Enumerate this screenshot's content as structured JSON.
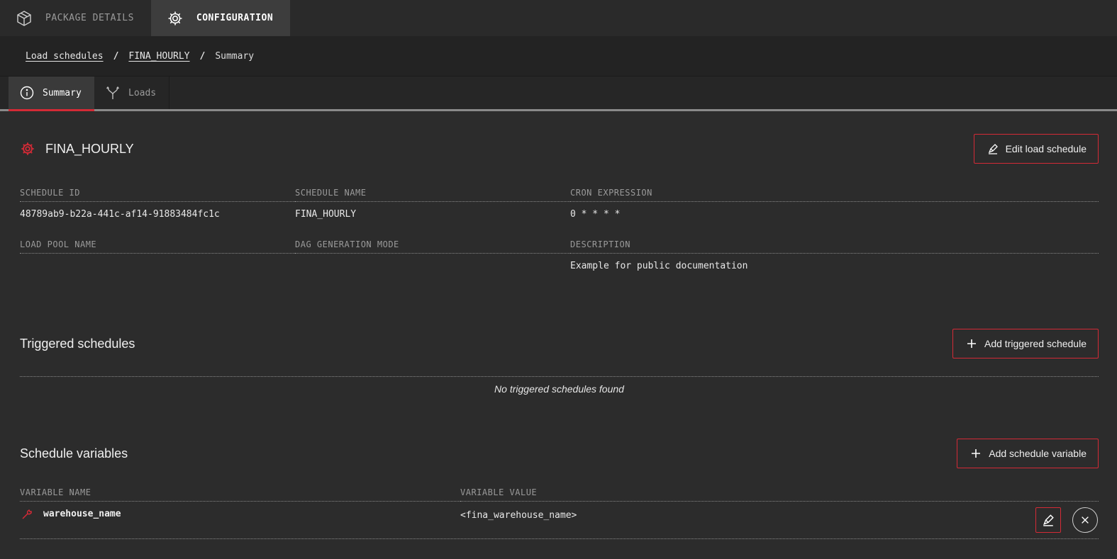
{
  "topnav": {
    "tabs": [
      {
        "label": "PACKAGE DETAILS",
        "icon": "package-icon"
      },
      {
        "label": "CONFIGURATION",
        "icon": "gear-icon"
      }
    ]
  },
  "breadcrumb": {
    "items": [
      "Load schedules",
      "FINA_HOURLY",
      "Summary"
    ],
    "separator": "/"
  },
  "subtabs": [
    {
      "label": "Summary",
      "icon": "info-icon"
    },
    {
      "label": "Loads",
      "icon": "merge-icon"
    }
  ],
  "schedule": {
    "title": "FINA_HOURLY",
    "edit_label": "Edit load schedule",
    "fields": {
      "schedule_id": {
        "label": "SCHEDULE ID",
        "value": "48789ab9-b22a-441c-af14-91883484fc1c"
      },
      "schedule_name": {
        "label": "SCHEDULE NAME",
        "value": "FINA_HOURLY"
      },
      "cron": {
        "label": "CRON EXPRESSION",
        "value": "0 * * * *"
      },
      "load_pool": {
        "label": "LOAD POOL NAME",
        "value": ""
      },
      "dag_mode": {
        "label": "DAG GENERATION MODE",
        "value": ""
      },
      "description": {
        "label": "DESCRIPTION",
        "value": "Example for public documentation"
      }
    }
  },
  "triggered": {
    "title": "Triggered schedules",
    "add_label": "Add triggered schedule",
    "empty": "No triggered schedules found"
  },
  "variables": {
    "title": "Schedule variables",
    "add_label": "Add schedule variable",
    "col_name": "VARIABLE NAME",
    "col_value": "VARIABLE VALUE",
    "rows": [
      {
        "name": "warehouse_name",
        "value": "<fina_warehouse_name>"
      }
    ]
  },
  "colors": {
    "accent": "#d42a36",
    "background": "#2c2c2c"
  }
}
